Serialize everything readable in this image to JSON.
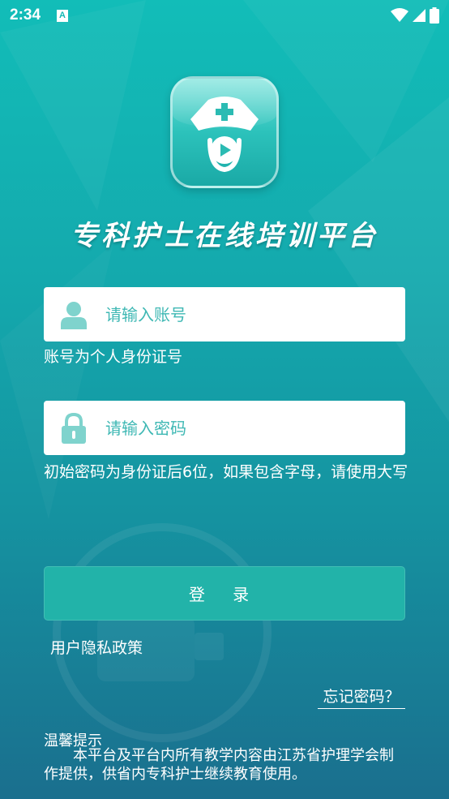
{
  "status_bar": {
    "time": "2:34",
    "notification_glyph": "A",
    "icons": [
      "wifi-icon",
      "cellular-signal-icon",
      "battery-icon"
    ]
  },
  "app": {
    "logo": "nurse-cap-play-logo",
    "title": "专科护士在线培训平台"
  },
  "account": {
    "placeholder": "请输入账号",
    "icon": "user-icon",
    "hint": "账号为个人身份证号"
  },
  "password": {
    "placeholder": "请输入密码",
    "icon": "lock-icon",
    "hint": "初始密码为身份证后6位，如果包含字母，请使用大写"
  },
  "login": {
    "label": "登 录"
  },
  "privacy_link": "用户隐私政策",
  "forgot_link": "忘记密码？",
  "tips": {
    "title": "温馨提示",
    "body": "本平台及平台内所有教学内容由江苏省护理学会制作提供，供省内专科护士继续教育使用。"
  },
  "colors": {
    "accent": "#22b3a9",
    "background_top": "#12bdb8",
    "background_bottom": "#1a6f8e",
    "placeholder": "#3fb8b4",
    "icon": "#7fd3cd"
  }
}
